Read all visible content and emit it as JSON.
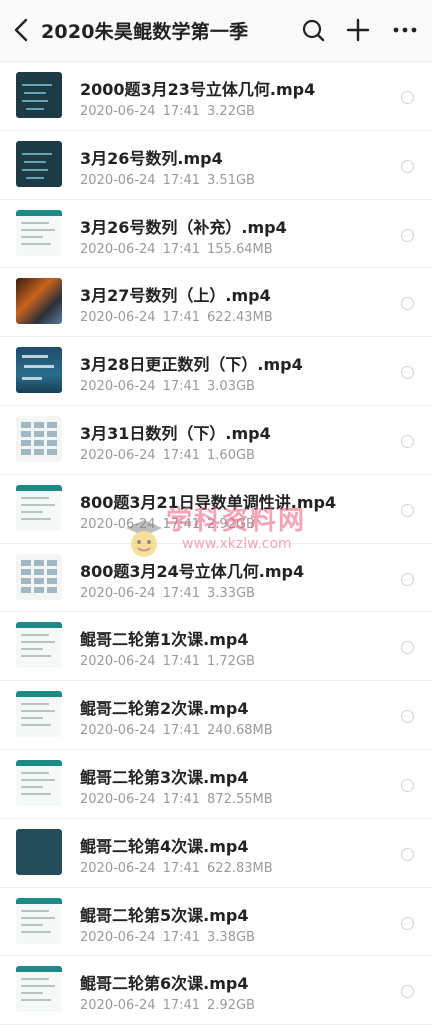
{
  "header": {
    "title": "2020朱昊鲲数学第一季"
  },
  "files": [
    {
      "name": "2000题3月23号立体几何.mp4",
      "date": "2020-06-24",
      "time": "17:41",
      "size": "3.22GB",
      "thumb": "dark"
    },
    {
      "name": "3月26号数列.mp4",
      "date": "2020-06-24",
      "time": "17:41",
      "size": "3.51GB",
      "thumb": "dark"
    },
    {
      "name": "3月26号数列（补充）.mp4",
      "date": "2020-06-24",
      "time": "17:41",
      "size": "155.64MB",
      "thumb": "white"
    },
    {
      "name": "3月27号数列（上）.mp4",
      "date": "2020-06-24",
      "time": "17:41",
      "size": "622.43MB",
      "thumb": "fire"
    },
    {
      "name": "3月28日更正数列（下）.mp4",
      "date": "2020-06-24",
      "time": "17:41",
      "size": "3.03GB",
      "thumb": "poster"
    },
    {
      "name": "3月31日数列（下）.mp4",
      "date": "2020-06-24",
      "time": "17:41",
      "size": "1.60GB",
      "thumb": "table"
    },
    {
      "name": "800题3月21日导数单调性讲.mp4",
      "date": "2020-06-24",
      "time": "17:41",
      "size": "2.92GB",
      "thumb": "white"
    },
    {
      "name": "800题3月24号立体几何.mp4",
      "date": "2020-06-24",
      "time": "17:41",
      "size": "3.33GB",
      "thumb": "table"
    },
    {
      "name": "鲲哥二轮第1次课.mp4",
      "date": "2020-06-24",
      "time": "17:41",
      "size": "1.72GB",
      "thumb": "white"
    },
    {
      "name": "鲲哥二轮第2次课.mp4",
      "date": "2020-06-24",
      "time": "17:41",
      "size": "240.68MB",
      "thumb": "white"
    },
    {
      "name": "鲲哥二轮第3次课.mp4",
      "date": "2020-06-24",
      "time": "17:41",
      "size": "872.55MB",
      "thumb": "white"
    },
    {
      "name": "鲲哥二轮第4次课.mp4",
      "date": "2020-06-24",
      "time": "17:41",
      "size": "622.83MB",
      "thumb": "slate"
    },
    {
      "name": "鲲哥二轮第5次课.mp4",
      "date": "2020-06-24",
      "time": "17:41",
      "size": "3.38GB",
      "thumb": "white"
    },
    {
      "name": "鲲哥二轮第6次课.mp4",
      "date": "2020-06-24",
      "time": "17:41",
      "size": "2.92GB",
      "thumb": "white"
    }
  ],
  "watermark": {
    "title": "学科资料网",
    "url": "www.xkzlw.com"
  },
  "icons": {
    "back": "back-arrow-icon",
    "search": "search-icon",
    "add": "plus-icon",
    "more": "more-dots-icon",
    "select": "radio-circle-icon"
  }
}
